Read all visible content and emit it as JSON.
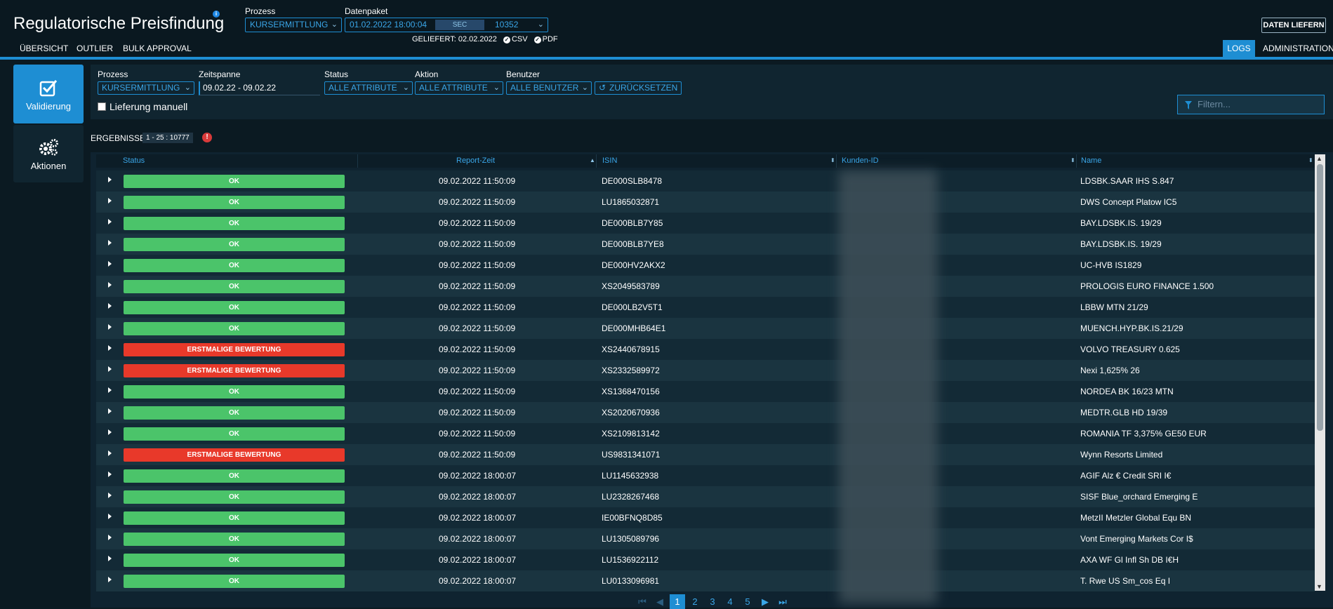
{
  "app": {
    "title": "Regulatorische Preisfindung",
    "info_icon": "info-icon"
  },
  "header": {
    "prozess_label": "Prozess",
    "prozess_value": "KURSERMITTLUNG",
    "datenpaket_label": "Datenpaket",
    "datenpaket_value": "01.02.2022 18:00:04",
    "datenpaket_sec": "SEC",
    "datenpaket_id": "10352",
    "geliefert_label": "GELIEFERT:",
    "geliefert_date": "02.02.2022",
    "csv_label": "CSV",
    "pdf_label": "PDF",
    "daten_liefern": "DATEN LIEFERN"
  },
  "nav": {
    "left": [
      "ÜBERSICHT",
      "OUTLIER",
      "BULK APPROVAL"
    ],
    "logs": "LOGS",
    "administration": "ADMINISTRATION"
  },
  "sidebar": {
    "validierung": "Validierung",
    "aktionen": "Aktionen"
  },
  "filters": {
    "prozess_label": "Prozess",
    "prozess_value": "KURSERMITTLUNG",
    "zeitspanne_label": "Zeitspanne",
    "zeitspanne_value": "09.02.22 - 09.02.22",
    "status_label": "Status",
    "status_value": "ALLE ATTRIBUTE",
    "aktion_label": "Aktion",
    "aktion_value": "ALLE ATTRIBUTE",
    "benutzer_label": "Benutzer",
    "benutzer_value": "ALLE BENUTZER",
    "reset_label": "ZURÜCKSETZEN",
    "lieferung_label": "Lieferung manuell",
    "search_placeholder": "Filtern..."
  },
  "results": {
    "title": "ERGEBNISSE",
    "count": "1 - 25 : 10777"
  },
  "table": {
    "columns": [
      "Status",
      "Report-Zeit",
      "ISIN",
      "Kunden-ID",
      "Name"
    ],
    "rows": [
      {
        "status": "OK",
        "time": "09.02.2022 11:50:09",
        "isin": "DE000SLB8478",
        "name": "LDSBK.SAAR IHS S.847"
      },
      {
        "status": "OK",
        "time": "09.02.2022 11:50:09",
        "isin": "LU1865032871",
        "name": "DWS Concept Platow IC5"
      },
      {
        "status": "OK",
        "time": "09.02.2022 11:50:09",
        "isin": "DE000BLB7Y85",
        "name": "BAY.LDSBK.IS. 19/29"
      },
      {
        "status": "OK",
        "time": "09.02.2022 11:50:09",
        "isin": "DE000BLB7YE8",
        "name": "BAY.LDSBK.IS. 19/29"
      },
      {
        "status": "OK",
        "time": "09.02.2022 11:50:09",
        "isin": "DE000HV2AKX2",
        "name": "UC-HVB IS1829"
      },
      {
        "status": "OK",
        "time": "09.02.2022 11:50:09",
        "isin": "XS2049583789",
        "name": "PROLOGIS EURO FINANCE 1.500"
      },
      {
        "status": "OK",
        "time": "09.02.2022 11:50:09",
        "isin": "DE000LB2V5T1",
        "name": "LBBW MTN 21/29"
      },
      {
        "status": "OK",
        "time": "09.02.2022 11:50:09",
        "isin": "DE000MHB64E1",
        "name": "MUENCH.HYP.BK.IS.21/29"
      },
      {
        "status": "ERSTMALIGE BEWERTUNG",
        "time": "09.02.2022 11:50:09",
        "isin": "XS2440678915",
        "name": "VOLVO TREASURY 0.625"
      },
      {
        "status": "ERSTMALIGE BEWERTUNG",
        "time": "09.02.2022 11:50:09",
        "isin": "XS2332589972",
        "name": "Nexi 1,625% 26"
      },
      {
        "status": "OK",
        "time": "09.02.2022 11:50:09",
        "isin": "XS1368470156",
        "name": "NORDEA BK 16/23 MTN"
      },
      {
        "status": "OK",
        "time": "09.02.2022 11:50:09",
        "isin": "XS2020670936",
        "name": "MEDTR.GLB HD 19/39"
      },
      {
        "status": "OK",
        "time": "09.02.2022 11:50:09",
        "isin": "XS2109813142",
        "name": "ROMANIA TF 3,375% GE50 EUR"
      },
      {
        "status": "ERSTMALIGE BEWERTUNG",
        "time": "09.02.2022 11:50:09",
        "isin": "US9831341071",
        "name": "Wynn Resorts Limited"
      },
      {
        "status": "OK",
        "time": "09.02.2022 18:00:07",
        "isin": "LU1145632938",
        "name": "AGIF Alz € Credit SRI I€"
      },
      {
        "status": "OK",
        "time": "09.02.2022 18:00:07",
        "isin": "LU2328267468",
        "name": "SISF Blue_orchard Emerging E"
      },
      {
        "status": "OK",
        "time": "09.02.2022 18:00:07",
        "isin": "IE00BFNQ8D85",
        "name": "MetzII Metzler Global Equ BN"
      },
      {
        "status": "OK",
        "time": "09.02.2022 18:00:07",
        "isin": "LU1305089796",
        "name": "Vont Emerging Markets Cor I$"
      },
      {
        "status": "OK",
        "time": "09.02.2022 18:00:07",
        "isin": "LU1536922112",
        "name": "AXA WF Gl Infl Sh DB I€H"
      },
      {
        "status": "OK",
        "time": "09.02.2022 18:00:07",
        "isin": "LU0133096981",
        "name": "T. Rwe US Sm_cos Eq I"
      }
    ]
  },
  "pagination": {
    "pages": [
      "1",
      "2",
      "3",
      "4",
      "5"
    ],
    "current": "1"
  },
  "colors": {
    "accent": "#1e8ed3",
    "ok": "#4bc46a",
    "error": "#e8392a",
    "background": "#0b1a22"
  }
}
